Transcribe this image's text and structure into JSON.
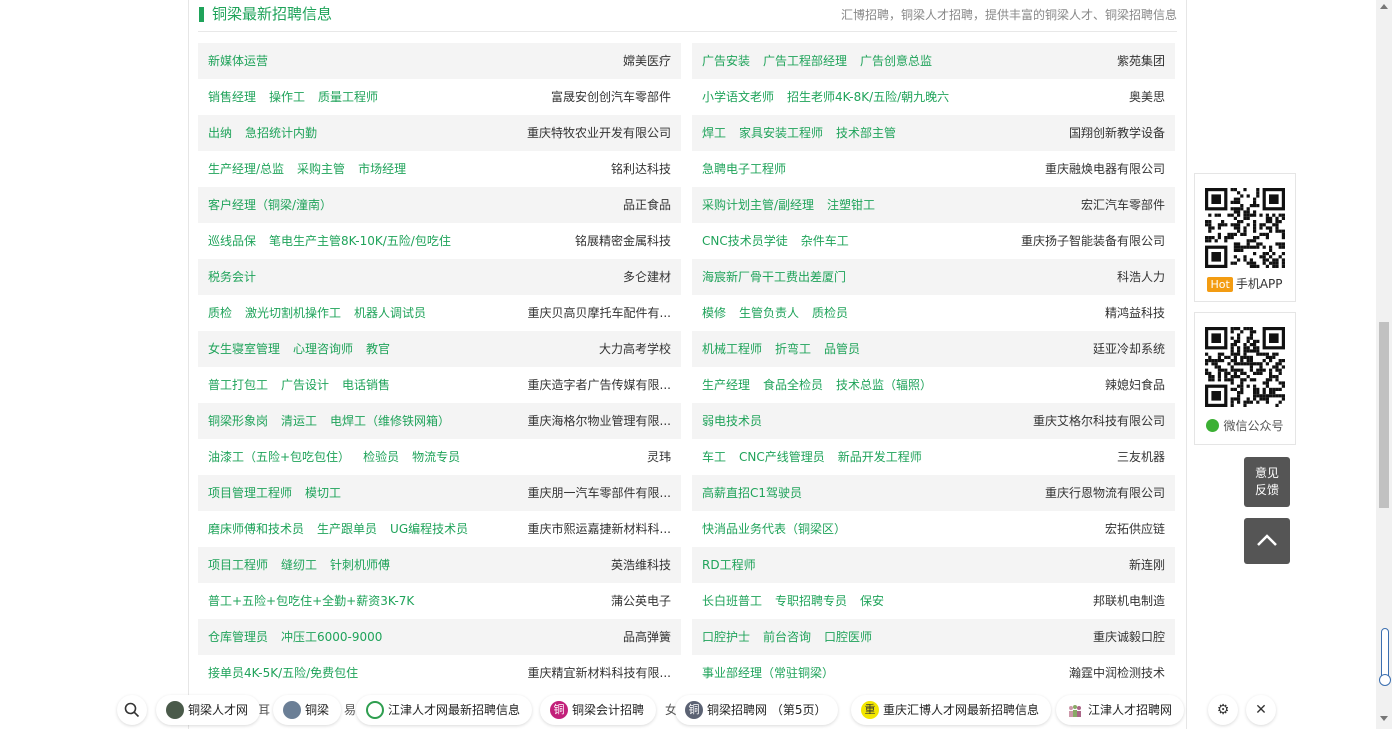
{
  "section": {
    "title": "铜梁最新招聘信息",
    "desc": "汇博招聘，铜梁人才招聘，提供丰富的铜梁人才、铜梁招聘信息"
  },
  "left_rows": [
    {
      "jobs": [
        "新媒体运营"
      ],
      "company": "嫦美医疗"
    },
    {
      "jobs": [
        "销售经理",
        "操作工",
        "质量工程师"
      ],
      "company": "富晟安创创汽车零部件"
    },
    {
      "jobs": [
        "出纳",
        "急招统计内勤"
      ],
      "company": "重庆特牧农业开发有限公司"
    },
    {
      "jobs": [
        "生产经理/总监",
        "采购主管",
        "市场经理"
      ],
      "company": "铭利达科技"
    },
    {
      "jobs": [
        "客户经理（铜梁/潼南）"
      ],
      "company": "品正食品"
    },
    {
      "jobs": [
        "巡线品保",
        "笔电生产主管8K-10K/五险/包吃住"
      ],
      "company": "铭展精密金属科技"
    },
    {
      "jobs": [
        "税务会计"
      ],
      "company": "多仑建材"
    },
    {
      "jobs": [
        "质检",
        "激光切割机操作工",
        "机器人调试员"
      ],
      "company": "重庆贝高贝摩托车配件有..."
    },
    {
      "jobs": [
        "女生寝室管理",
        "心理咨询师",
        "教官"
      ],
      "company": "大力高考学校"
    },
    {
      "jobs": [
        "普工打包工",
        "广告设计",
        "电话销售"
      ],
      "company": "重庆造字者广告传媒有限..."
    },
    {
      "jobs": [
        "铜梁形象岗",
        "清运工",
        "电焊工（维修铁网箱）"
      ],
      "company": "重庆海格尔物业管理有限..."
    },
    {
      "jobs": [
        "油漆工（五险+包吃包住）",
        "检验员",
        "物流专员"
      ],
      "company": "灵玮"
    },
    {
      "jobs": [
        "项目管理工程师",
        "模切工"
      ],
      "company": "重庆朋一汽车零部件有限..."
    },
    {
      "jobs": [
        "磨床师傅和技术员",
        "生产跟单员",
        "UG编程技术员"
      ],
      "company": "重庆市熙运嘉捷新材料科..."
    },
    {
      "jobs": [
        "项目工程师",
        "缝纫工",
        "针刺机师傅"
      ],
      "company": "英浩维科技"
    },
    {
      "jobs": [
        "普工+五险+包吃住+全勤+薪资3K-7K"
      ],
      "company": "蒲公英电子"
    },
    {
      "jobs": [
        "仓库管理员",
        "冲压工6000-9000"
      ],
      "company": "品高弹簧"
    },
    {
      "jobs": [
        "接单员4K-5K/五险/免费包住"
      ],
      "company": "重庆精宜新材料科技有限..."
    }
  ],
  "right_rows": [
    {
      "jobs": [
        "广告安装",
        "广告工程部经理",
        "广告创意总监"
      ],
      "company": "紫苑集团"
    },
    {
      "jobs": [
        "小学语文老师",
        "招生老师4K-8K/五险/朝九晚六"
      ],
      "company": "奥美思"
    },
    {
      "jobs": [
        "焊工",
        "家具安装工程师",
        "技术部主管"
      ],
      "company": "国翔创新教学设备"
    },
    {
      "jobs": [
        "急聘电子工程师"
      ],
      "company": "重庆融焕电器有限公司"
    },
    {
      "jobs": [
        "采购计划主管/副经理",
        "注塑钳工"
      ],
      "company": "宏汇汽车零部件"
    },
    {
      "jobs": [
        "CNC技术员学徒",
        "杂件车工"
      ],
      "company": "重庆扬子智能装备有限公司"
    },
    {
      "jobs": [
        "海宸新厂骨干工费出差厦门"
      ],
      "company": "科浩人力"
    },
    {
      "jobs": [
        "模修",
        "生管负责人",
        "质检员"
      ],
      "company": "精鸿益科技"
    },
    {
      "jobs": [
        "机械工程师",
        "折弯工",
        "品管员"
      ],
      "company": "廷亚冷却系统"
    },
    {
      "jobs": [
        "生产经理",
        "食品全检员",
        "技术总监（辐照）"
      ],
      "company": "辣媳妇食品"
    },
    {
      "jobs": [
        "弱电技术员"
      ],
      "company": "重庆艾格尔科技有限公司"
    },
    {
      "jobs": [
        "车工",
        "CNC产线管理员",
        "新品开发工程师"
      ],
      "company": "三友机器"
    },
    {
      "jobs": [
        "高薪直招C1驾驶员"
      ],
      "company": "重庆行恩物流有限公司"
    },
    {
      "jobs": [
        "快消品业务代表（铜梁区）"
      ],
      "company": "宏拓供应链"
    },
    {
      "jobs": [
        "RD工程师"
      ],
      "company": "新连刚"
    },
    {
      "jobs": [
        "长白班普工",
        "专职招聘专员",
        "保安"
      ],
      "company": "邦联机电制造"
    },
    {
      "jobs": [
        "口腔护士",
        "前台咨询",
        "口腔医师"
      ],
      "company": "重庆诚毅口腔"
    },
    {
      "jobs": [
        "事业部经理（常驻铜梁）"
      ],
      "company": "瀚霆中润检测技术"
    }
  ],
  "widgets": {
    "app_hot": "Hot",
    "app_label": "手机APP",
    "wechat_label": "微信公众号",
    "feedback_line1": "意见",
    "feedback_line2": "反馈"
  },
  "bottom_bar": {
    "ghost_1": "耳",
    "ghost_2": "易",
    "ghost_3": "女",
    "pills": [
      "铜梁人才网",
      "铜梁",
      "江津人才网最新招聘信息",
      "铜梁会计招聘",
      "铜梁招聘网 （第5页）",
      "重庆汇博人才网最新招聘信息",
      "江津人才招聘网"
    ],
    "pill_icons": [
      "铜",
      "重"
    ],
    "close_icon": "✕",
    "settings_icon": "⚙"
  }
}
